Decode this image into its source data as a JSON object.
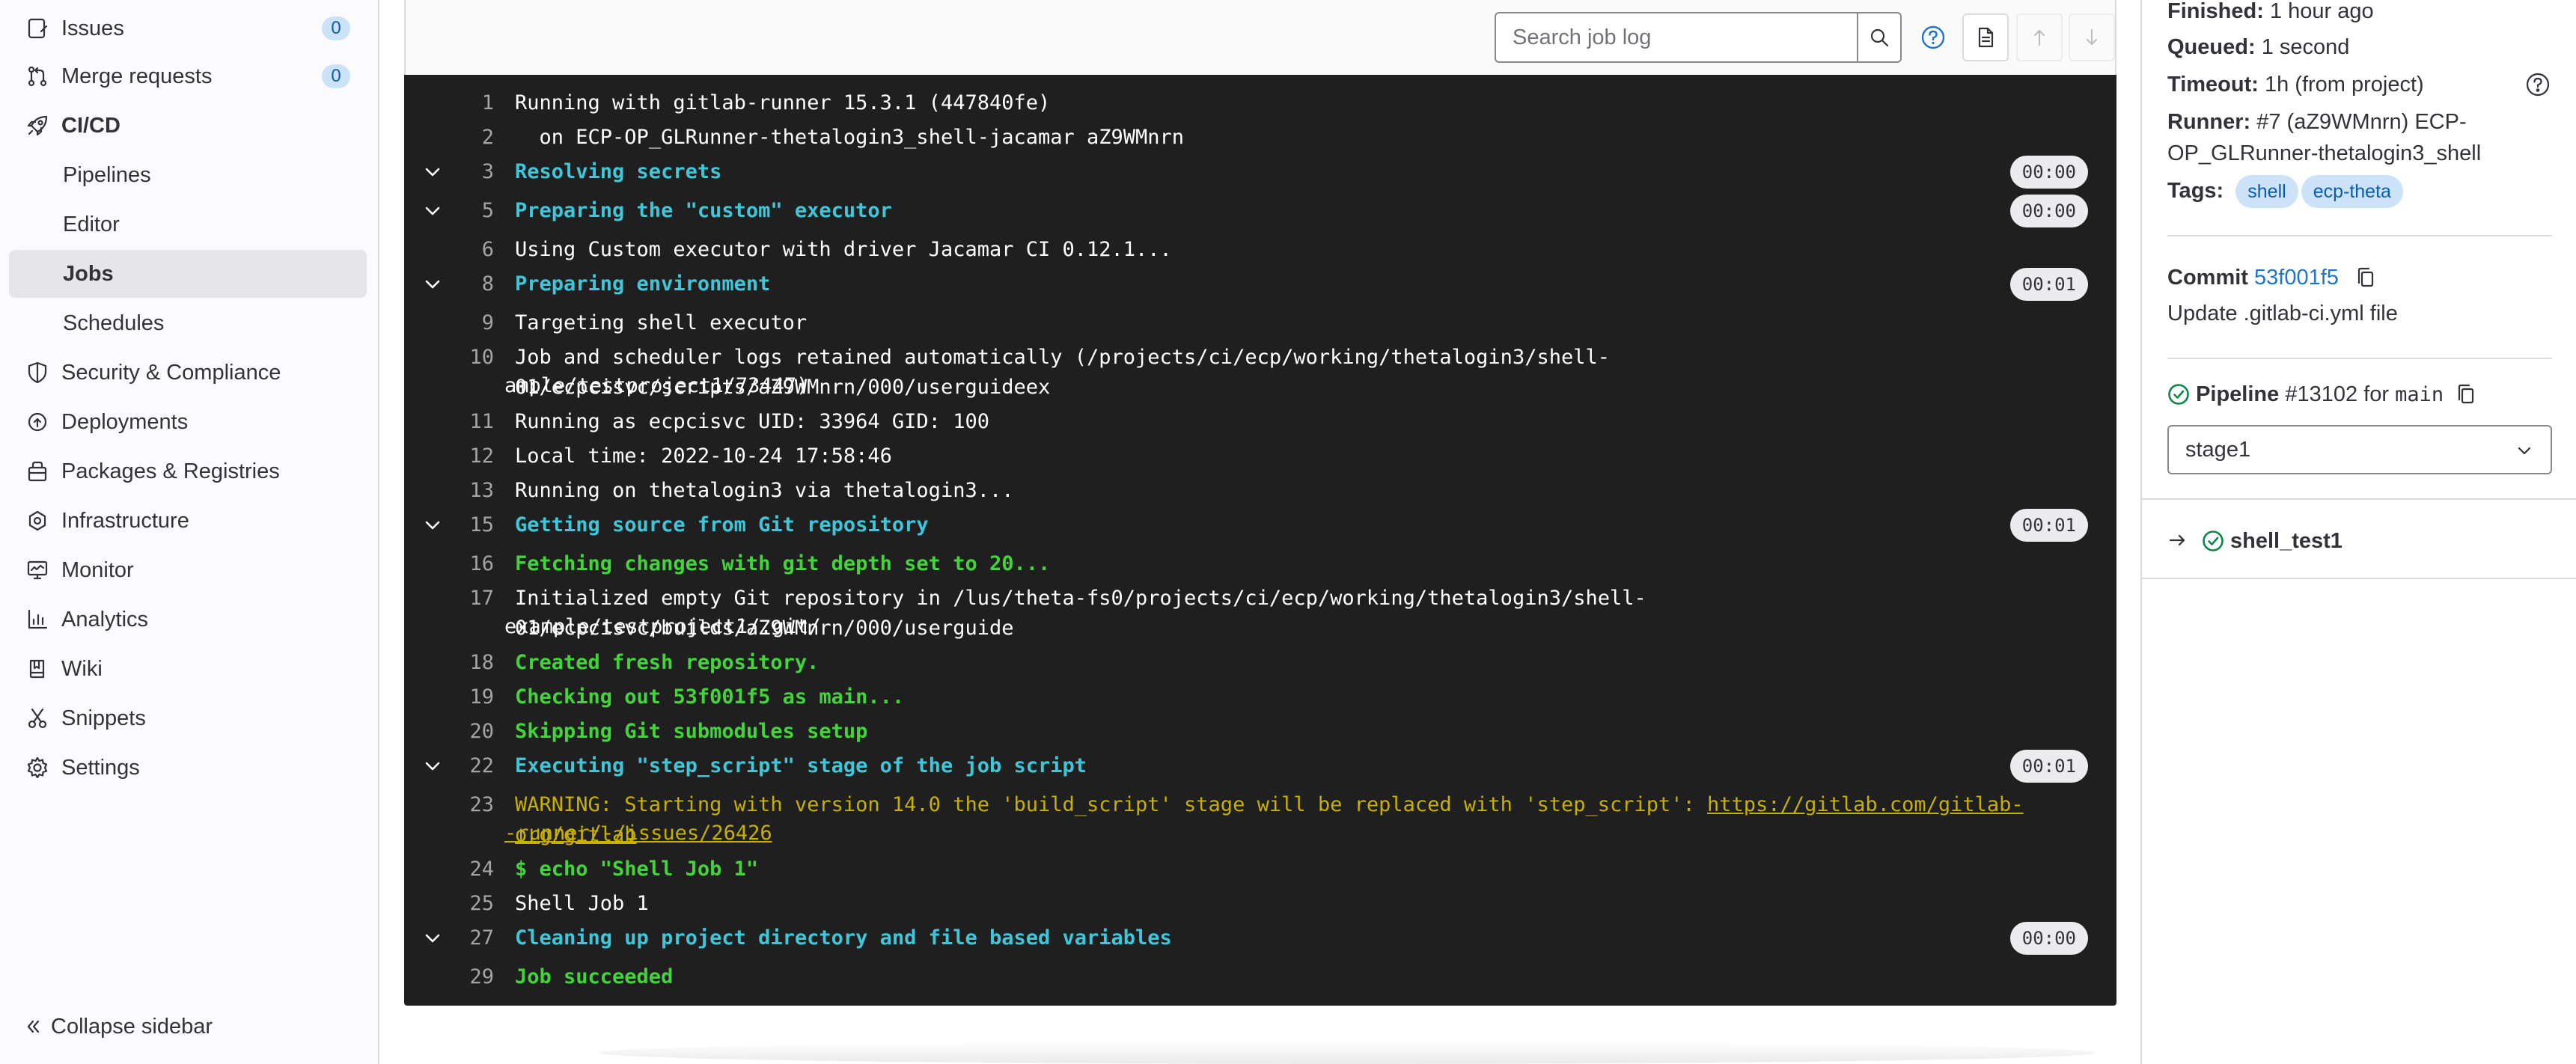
{
  "sidebar": {
    "issues": {
      "label": "Issues",
      "count": "0"
    },
    "merge_requests": {
      "label": "Merge requests",
      "count": "0"
    },
    "cicd": {
      "label": "CI/CD"
    },
    "cicd_items": [
      "Pipelines",
      "Editor",
      "Jobs",
      "Schedules"
    ],
    "security": "Security & Compliance",
    "deployments": "Deployments",
    "packages": "Packages & Registries",
    "infrastructure": "Infrastructure",
    "monitor": "Monitor",
    "analytics": "Analytics",
    "wiki": "Wiki",
    "snippets": "Snippets",
    "settings": "Settings",
    "collapse": "Collapse sidebar",
    "active_item": "Jobs"
  },
  "toolbar": {
    "search_placeholder": "Search job log"
  },
  "log": {
    "l1_num": "1",
    "l1": "Running with gitlab-runner 15.3.1 (447840fe)",
    "l2_num": "2",
    "l2": "  on ECP-OP_GLRunner-thetalogin3_shell-jacamar aZ9WMnrn",
    "l3_num": "3",
    "l3": "Resolving secrets",
    "l3_dur": "00:00",
    "l5_num": "5",
    "l5": "Preparing the \"custom\" executor",
    "l5_dur": "00:00",
    "l6_num": "6",
    "l6": "Using Custom executor with driver Jacamar CI 0.12.1...",
    "l8_num": "8",
    "l8": "Preparing environment",
    "l8_dur": "00:01",
    "l9_num": "9",
    "l9": "Targeting shell executor",
    "l10_num": "10",
    "l10a": "Job and scheduler logs retained automatically (/projects/ci/ecp/working/thetalogin3/shell-01/ecpcisvc/scripts/aZ9WMnrn/000/userguideex",
    "l10b": "ample/testproject1/73447)",
    "l11_num": "11",
    "l11": "Running as ecpcisvc UID: 33964 GID: 100",
    "l12_num": "12",
    "l12": "Local time: 2022-10-24 17:58:46",
    "l13_num": "13",
    "l13": "Running on thetalogin3 via thetalogin3...",
    "l15_num": "15",
    "l15": "Getting source from Git repository",
    "l15_dur": "00:01",
    "l16_num": "16",
    "l16": "Fetching changes with git depth set to 20...",
    "l17_num": "17",
    "l17a": "Initialized empty Git repository in /lus/theta-fs0/projects/ci/ecp/working/thetalogin3/shell-01/ecpcisvc/builds/aZ9WMnrn/000/userguide",
    "l17b": "example/testproject1/.git/",
    "l18_num": "18",
    "l18": "Created fresh repository.",
    "l19_num": "19",
    "l19": "Checking out 53f001f5 as main...",
    "l20_num": "20",
    "l20": "Skipping Git submodules setup",
    "l22_num": "22",
    "l22": "Executing \"step_script\" stage of the job script",
    "l22_dur": "00:01",
    "l23_num": "23",
    "l23a": "WARNING: Starting with version 14.0 the 'build_script' stage will be replaced with 'step_script': ",
    "l23_link1": "https://gitlab.com/gitlab-org/gitlab",
    "l23_link2": "-runner/-/issues/26426",
    "l24_num": "24",
    "l24": "$ echo \"Shell Job 1\"",
    "l25_num": "25",
    "l25": "Shell Job 1",
    "l27_num": "27",
    "l27": "Cleaning up project directory and file based variables",
    "l27_dur": "00:00",
    "l29_num": "29",
    "l29": "Job succeeded"
  },
  "details": {
    "finished_label": "Finished:",
    "finished_value": "1 hour ago",
    "queued_label": "Queued:",
    "queued_value": "1 second",
    "timeout_label": "Timeout:",
    "timeout_value": "1h (from project)",
    "runner_label": "Runner:",
    "runner_value_1": "#7 (aZ9WMnrn) ECP-",
    "runner_value_2": "OP_GLRunner-thetalogin3_shell",
    "tags_label": "Tags:",
    "tags": [
      "shell",
      "ecp-theta"
    ],
    "commit_label": "Commit",
    "commit_sha": "53f001f5",
    "commit_message": "Update .gitlab-ci.yml file",
    "pipeline_label": "Pipeline",
    "pipeline_id": "#13102",
    "pipeline_for": "for",
    "pipeline_ref": "main",
    "stage_selected": "stage1",
    "job_name": "shell_test1"
  },
  "colors": {
    "accent_blue": "#1f75cb",
    "success_green": "#108548",
    "log_bg": "#1f1f1f",
    "log_cyan": "#3fc6d8",
    "log_green": "#43d43c",
    "log_yellow": "#c7b000"
  }
}
